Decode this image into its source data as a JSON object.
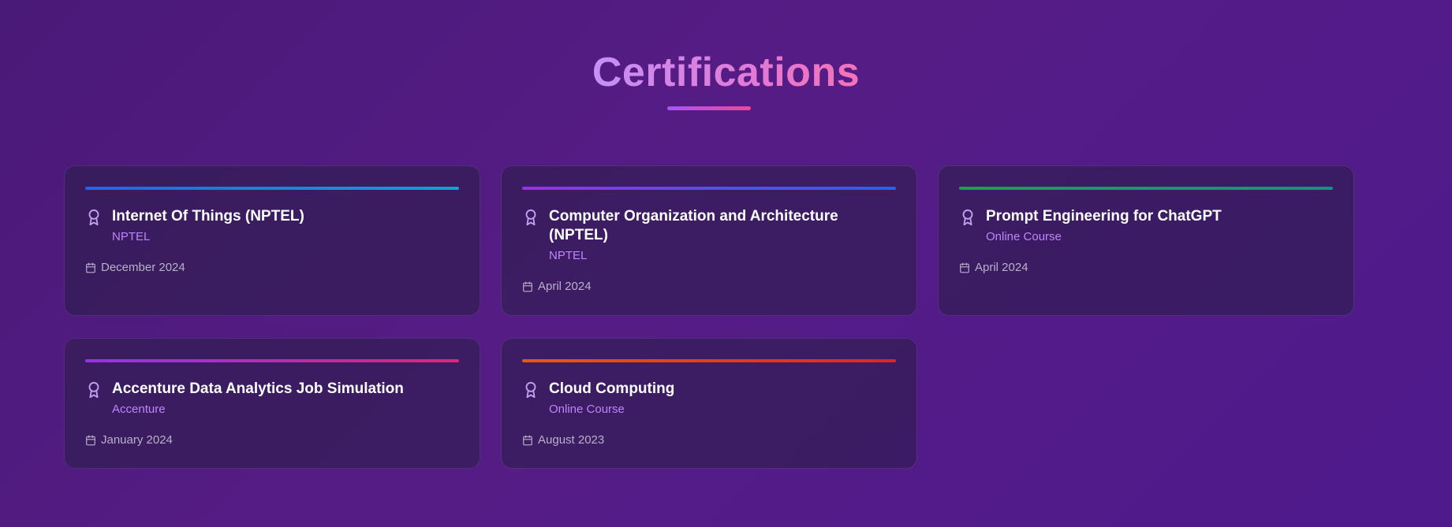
{
  "section": {
    "title": "Certifications"
  },
  "certifications": [
    {
      "title": "Internet Of Things (NPTEL)",
      "issuer": "NPTEL",
      "date": "December 2024",
      "icon": "award-icon",
      "accent_from": "#2563eb",
      "accent_to": "#0ea5c9"
    },
    {
      "title": "Computer Organization and Architecture (NPTEL)",
      "issuer": "NPTEL",
      "date": "April 2024",
      "icon": "award-icon",
      "accent_from": "#9333ea",
      "accent_to": "#2563eb"
    },
    {
      "title": "Prompt Engineering for ChatGPT",
      "issuer": "Online Course",
      "date": "April 2024",
      "icon": "award-icon",
      "accent_from": "#16a34a",
      "accent_to": "#0d9488"
    },
    {
      "title": "Accenture Data Analytics Job Simulation",
      "issuer": "Accenture",
      "date": "January 2024",
      "icon": "award-icon",
      "accent_from": "#9333ea",
      "accent_to": "#db2777"
    },
    {
      "title": "Cloud Computing",
      "issuer": "Online Course",
      "date": "August 2023",
      "icon": "award-icon",
      "accent_from": "#ea580c",
      "accent_to": "#dc2626"
    }
  ],
  "colors": {
    "issuer": "#c084fc",
    "icon": "#c4a0f0",
    "date_text": "#b9b1c8"
  }
}
